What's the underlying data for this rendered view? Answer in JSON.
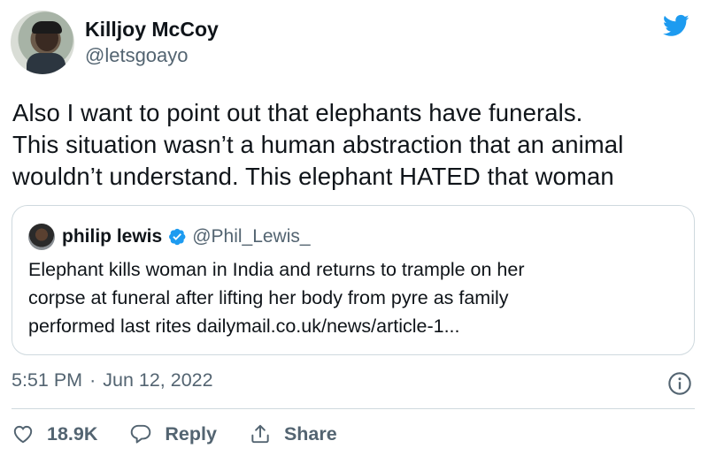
{
  "author": {
    "display_name": "Killjoy McCoy",
    "handle": "@letsgoayo",
    "avatar_icon": "user-avatar"
  },
  "brand": {
    "icon": "twitter-bird-icon",
    "color": "#1d9bf0"
  },
  "tweet": {
    "text": "Also I want to point out that elephants have funerals.\nThis situation wasn’t a human abstraction that an animal\nwouldn’t understand. This elephant HATED that woman"
  },
  "quoted_tweet": {
    "display_name": "philip lewis",
    "verified_icon": "verified-badge-icon",
    "handle": "@Phil_Lewis_",
    "text": "Elephant kills woman in India and returns to trample on her\ncorpse at funeral after lifting her body from pyre as family\nperformed last rites dailymail.co.uk/news/article-1..."
  },
  "meta": {
    "time": "5:51 PM",
    "separator": "·",
    "date": "Jun 12, 2022",
    "info_icon": "info-icon"
  },
  "actions": {
    "like_count": "18.9K",
    "reply_label": "Reply",
    "share_label": "Share"
  }
}
